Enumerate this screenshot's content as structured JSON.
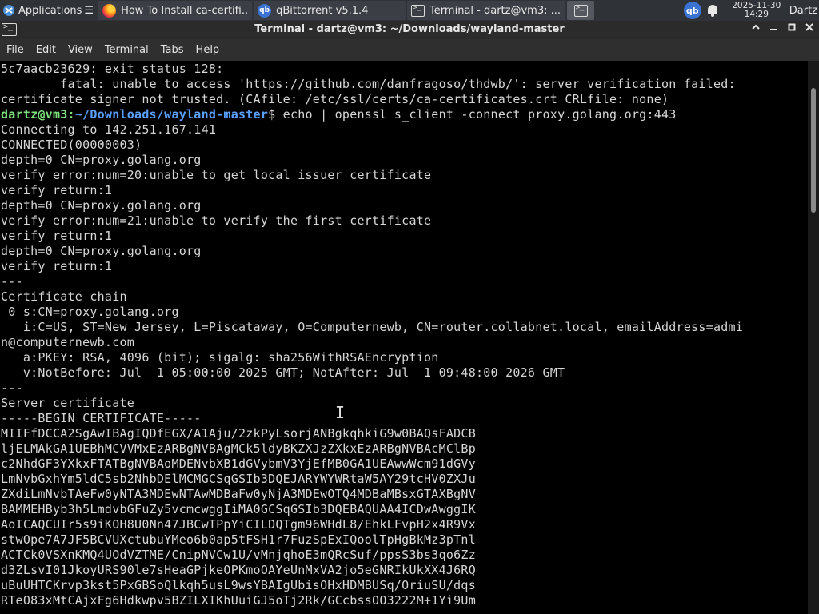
{
  "taskbar": {
    "apps_label": "Applications",
    "apps_chevron": "☰",
    "tasks": [
      {
        "label": "How To Install ca-certifi...",
        "icon": "firefox-icon"
      },
      {
        "label": "qBittorrent v5.1.4",
        "icon": "qbittorrent-icon"
      },
      {
        "label": "Terminal - dartz@vm3: ...",
        "icon": "terminal-icon"
      }
    ],
    "tray_qbt_label": "qb",
    "clock_date": "2025-11-30",
    "clock_time": "14:29",
    "user": "Dartz"
  },
  "window": {
    "title": "Terminal - dartz@vm3: ~/Downloads/wayland-master"
  },
  "menu": {
    "items": [
      "File",
      "Edit",
      "View",
      "Terminal",
      "Tabs",
      "Help"
    ]
  },
  "terminal": {
    "prompt_user": "dartz@vm3",
    "prompt_sep": ":",
    "prompt_path": "~/Downloads/wayland-master",
    "prompt_dollar": "$",
    "command": " echo | openssl s_client -connect proxy.golang.org:443",
    "lines_before": [
      "5c7aacb23629: exit status 128:",
      "        fatal: unable to access 'https://github.com/danfragoso/thdwb/': server verification failed:",
      "certificate signer not trusted. (CAfile: /etc/ssl/certs/ca-certificates.crt CRLfile: none)"
    ],
    "lines_after": [
      "Connecting to 142.251.167.141",
      "CONNECTED(00000003)",
      "depth=0 CN=proxy.golang.org",
      "verify error:num=20:unable to get local issuer certificate",
      "verify return:1",
      "depth=0 CN=proxy.golang.org",
      "verify error:num=21:unable to verify the first certificate",
      "verify return:1",
      "depth=0 CN=proxy.golang.org",
      "verify return:1",
      "---",
      "Certificate chain",
      " 0 s:CN=proxy.golang.org",
      "   i:C=US, ST=New Jersey, L=Piscataway, O=Computernewb, CN=router.collabnet.local, emailAddress=admi",
      "n@computernewb.com",
      "   a:PKEY: RSA, 4096 (bit); sigalg: sha256WithRSAEncryption",
      "   v:NotBefore: Jul  1 05:00:00 2025 GMT; NotAfter: Jul  1 09:48:00 2026 GMT",
      "---",
      "Server certificate",
      "-----BEGIN CERTIFICATE-----",
      "MIIFfDCCA2SgAwIBAgIQDfEGX/A1Aju/2zkPyLsorjANBgkqhkiG9w0BAQsFADCB",
      "ljELMAkGA1UEBhMCVVMxEzARBgNVBAgMCk5ldyBKZXJzZXkxEzARBgNVBAcMClBp",
      "c2NhdGF3YXkxFTATBgNVBAoMDENvbXB1dGVybmV3YjEfMB0GA1UEAwwWcm91dGVy",
      "LmNvbGxhYm5ldC5sb2NhbDElMCMGCSqGSIb3DQEJARYWYWRtaW5AY29tcHV0ZXJu",
      "ZXdiLmNvbTAeFw0yNTA3MDEwNTAwMDBaFw0yNjA3MDEwOTQ4MDBaMBsxGTAXBgNV",
      "BAMMEHByb3h5LmdvbGFuZy5vcmcwggIiMA0GCSqGSIb3DQEBAQUAA4ICDwAwggIK",
      "AoICAQCUIr5s9iKOH8U0Nn47JBCwTPpYiCILDQTgm96WHdL8/EhkLFvpH2x4R9Vx",
      "stwOpe7A7JF5BCVUXctubuYMeo6b0ap5tFSH1r7FuzSpExIQoolTpHgBkMz3pTnl",
      "ACTCk0VSXnKMQ4UOdVZTME/CnipNVCw1U/vMnjqhoE3mQRcSuf/ppsS3bs3qo6Zz",
      "d3ZLsvI01JkoyURS90le7sHeaGPjkeOPKmoOAYeUnMxVA2jo5eGNRIkUkXX4J6RQ",
      "uBuUHTCKrvp3kst5PxGBSoQlkqh5usL9wsYBAIgUbisOHxHDMBUSq/OriuSU/dqs",
      "RTeO83xMtCAjxFg6Hdkwpv5BZILXIKhUuiGJ5oTj2Rk/GCcbssOO3222M+1Yi9Um"
    ]
  },
  "colors": {
    "prompt_user": "#7de07d",
    "prompt_path": "#5aa0ff",
    "text": "#d6d6d6",
    "background": "#000000"
  }
}
